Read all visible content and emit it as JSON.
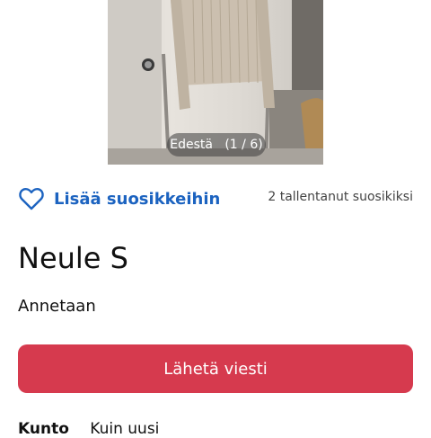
{
  "photo": {
    "caption": "Edestä   (1 / 6)"
  },
  "favorite": {
    "icon": "heart-icon",
    "link_label": "Lisää suosikkeihin",
    "saved_count_text": "2 tallentanut suosikiksi"
  },
  "item": {
    "title": "Neule S",
    "price_text": "Annetaan"
  },
  "actions": {
    "send_message_label": "Lähetä viesti"
  },
  "details": {
    "condition_label": "Kunto",
    "condition_value": "Kuin uusi"
  },
  "colors": {
    "accent_blue": "#1c63c0",
    "primary_button": "#d63a4e"
  }
}
